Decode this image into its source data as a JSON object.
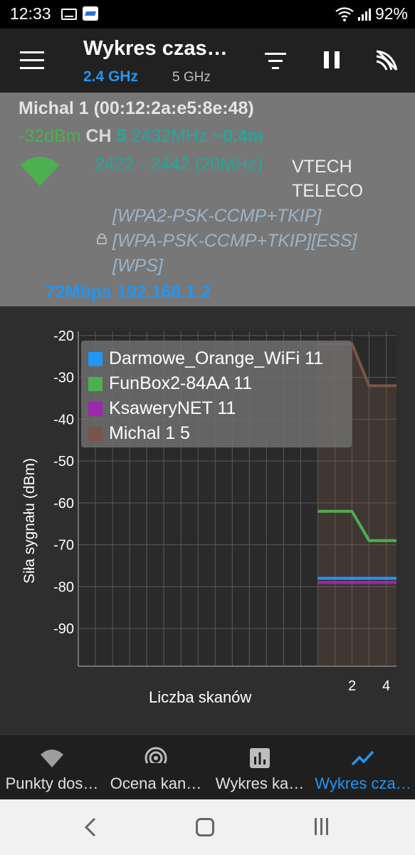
{
  "status_bar": {
    "time": "12:33",
    "battery": "92%",
    "icons": [
      "keyboard-icon",
      "app-notification-icon",
      "wifi-icon",
      "cell-signal-icon"
    ]
  },
  "toolbar": {
    "title": "Wykres czas…",
    "band_selected": "2.4 GHz",
    "band_other": "5 GHz",
    "icons": [
      "menu-icon",
      "filter-icon",
      "pause-icon",
      "scan-signal-icon"
    ]
  },
  "network": {
    "ssid": "Michal 1 (00:12:2a:e5:8e:48)",
    "signal": "-32dBm",
    "channel_label": "CH",
    "channel": "5",
    "frequency": "2432MHz",
    "distance": "~0.4m",
    "range": "2422 - 2442 (20MHz)",
    "vendor_line1": "VTECH",
    "vendor_line2": "TELECO",
    "security_line1": "[WPA2-PSK-CCMP+TKIP]",
    "security_line2": "[WPA-PSK-CCMP+TKIP][ESS]",
    "security_line3": "[WPS]",
    "rate": "72Mbps",
    "ip": "192.168.1.2"
  },
  "chart_data": {
    "type": "line",
    "ylabel": "Siła sygnału (dBm)",
    "xlabel": "Liczba skanów",
    "ylim": [
      -99,
      -19
    ],
    "y_ticks": [
      -20,
      -30,
      -40,
      -50,
      -60,
      -70,
      -80,
      -90
    ],
    "x_ticks": [
      2,
      4
    ],
    "x_tick_labels": [
      "2",
      "4"
    ],
    "xlim": [
      -14,
      4.6
    ],
    "grid": true,
    "legend_position": "top-left",
    "series": [
      {
        "name": "Darmowe_Orange_WiFi 11",
        "color": "#2196f3",
        "x": [
          0,
          1,
          2,
          3,
          4,
          4.6
        ],
        "y": [
          -78,
          -78,
          -78,
          -78,
          -78,
          -78
        ]
      },
      {
        "name": "FunBox2-84AA 11",
        "color": "#4caf50",
        "x": [
          0,
          1,
          2,
          3,
          4,
          4.6
        ],
        "y": [
          -62,
          -62,
          -62,
          -69,
          -69,
          -69
        ]
      },
      {
        "name": "KsaweryNET 11",
        "color": "#9c27b0",
        "x": [
          0,
          1,
          2,
          3,
          4,
          4.6
        ],
        "y": [
          -79,
          -79,
          -79,
          -79,
          -79,
          -79
        ]
      },
      {
        "name": "Michal 1 5",
        "color": "#795548",
        "x": [
          0,
          1,
          2,
          3,
          4,
          4.6
        ],
        "y": [
          -22,
          -22,
          -22,
          -32,
          -32,
          -32
        ]
      }
    ]
  },
  "bottom_nav": {
    "items": [
      {
        "label": "Punkty dos…",
        "icon": "wifi-icon"
      },
      {
        "label": "Ocena kan…",
        "icon": "radar-icon"
      },
      {
        "label": "Wykres ka…",
        "icon": "bar-chart-icon"
      },
      {
        "label": "Wykres cza…",
        "icon": "line-chart-icon",
        "active": true
      }
    ]
  },
  "system_nav": {
    "icons": [
      "back-icon",
      "home-icon",
      "recent-apps-icon"
    ]
  },
  "colors": {
    "accent": "#2196f3",
    "panel": "#777777",
    "chart_background": "#2e2e2e"
  }
}
